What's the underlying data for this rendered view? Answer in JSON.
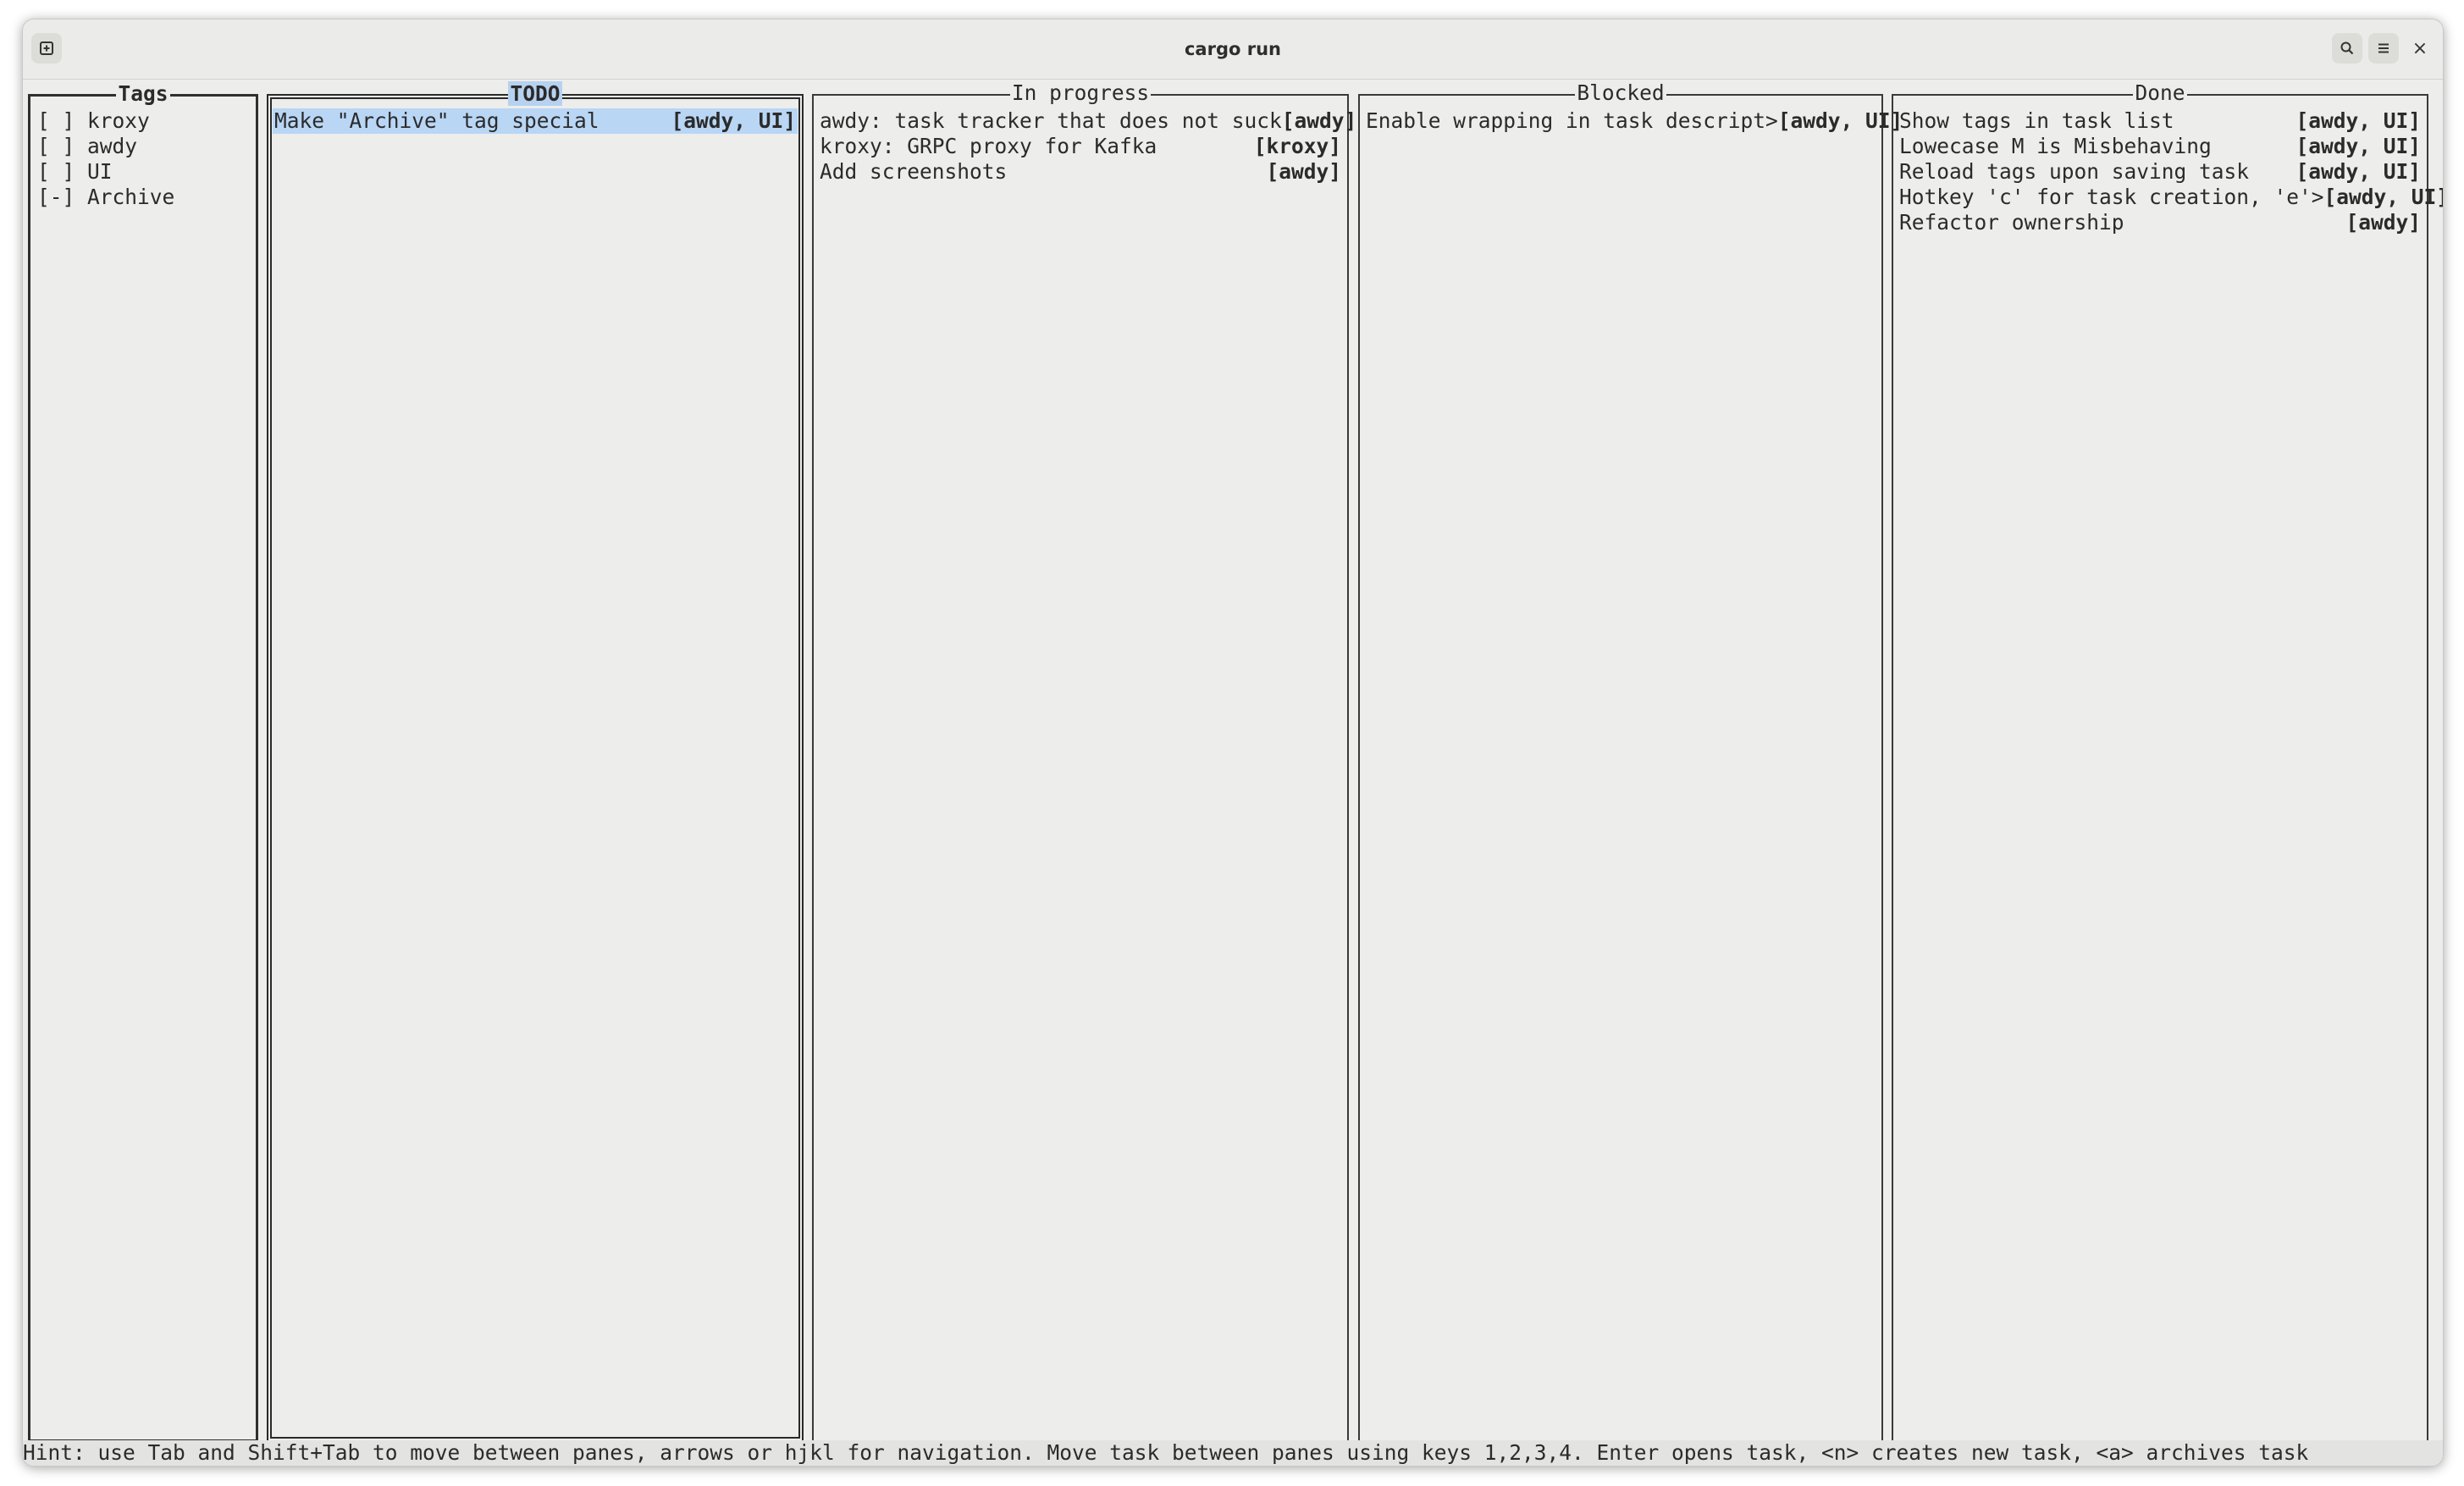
{
  "window": {
    "title": "cargo run"
  },
  "titlebar": {
    "left_icon": "new-tab-icon",
    "right_icons": [
      "search-icon",
      "hamburger-menu-icon",
      "close-icon"
    ],
    "close_glyph": "×"
  },
  "panes": {
    "tags": {
      "title": "Tags",
      "items": [
        {
          "check": "[ ]",
          "label": "kroxy"
        },
        {
          "check": "[ ]",
          "label": "awdy"
        },
        {
          "check": "[ ]",
          "label": "UI"
        },
        {
          "check": "[-]",
          "label": "Archive"
        }
      ]
    },
    "todo": {
      "title": "TODO",
      "tasks": [
        {
          "text": "Make \"Archive\" tag special",
          "tags": "[awdy, UI]",
          "selected": true
        }
      ]
    },
    "in_progress": {
      "title": "In progress",
      "tasks": [
        {
          "text": "awdy: task tracker that does not suck",
          "tags": "[awdy]"
        },
        {
          "text": "kroxy: GRPC proxy for Kafka",
          "tags": "[kroxy]"
        },
        {
          "text": "Add screenshots",
          "tags": "[awdy]"
        }
      ]
    },
    "blocked": {
      "title": "Blocked",
      "tasks": [
        {
          "text": "Enable wrapping in task descript>",
          "tags": "[awdy, UI]"
        }
      ]
    },
    "done": {
      "title": "Done",
      "tasks": [
        {
          "text": "Show tags in task list",
          "tags": "[awdy, UI]"
        },
        {
          "text": "Lowecase M is Misbehaving",
          "tags": "[awdy, UI]"
        },
        {
          "text": "Reload tags upon saving task",
          "tags": "[awdy, UI]"
        },
        {
          "text": "Hotkey 'c' for task creation, 'e'>",
          "tags": "[awdy, UI]"
        },
        {
          "text": "Refactor ownership",
          "tags": "[awdy]"
        }
      ]
    }
  },
  "hint": "Hint: use Tab and Shift+Tab to move between panes, arrows or hjkl for navigation. Move task between panes using keys 1,2,3,4. Enter opens task, <n> creates new task, <a> archives task",
  "colors": {
    "terminal_bg": "#ededeb",
    "selection": "#b9d6f5",
    "text": "#2b2b2b"
  }
}
